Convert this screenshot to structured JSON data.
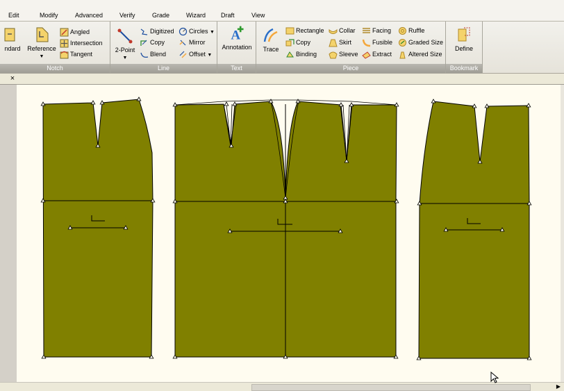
{
  "menubar": {
    "items": [
      "Edit",
      "Modify",
      "Advanced",
      "Verify",
      "Grade",
      "Wizard",
      "Draft",
      "View"
    ]
  },
  "ribbon": {
    "groups": {
      "notch": {
        "label": "Notch",
        "buttons": [
          "ndard",
          "Reference",
          "Angled",
          "Intersection",
          "Tangent"
        ]
      },
      "line": {
        "label": "Line",
        "buttons": [
          "2-Point",
          "Digitized",
          "Copy",
          "Blend",
          "Circles",
          "Mirror",
          "Offset"
        ]
      },
      "text": {
        "label": "Text",
        "buttons": [
          "Annotation"
        ]
      },
      "piece": {
        "label": "Piece",
        "buttons": [
          "Trace",
          "Rectangle",
          "Copy",
          "Binding",
          "Collar",
          "Skirt",
          "Sleeve",
          "Facing",
          "Fusible",
          "Extract",
          "Ruffle",
          "Graded Size",
          "Altered Size"
        ]
      },
      "bookmark": {
        "label": "Bookmark",
        "buttons": [
          "Define"
        ]
      }
    }
  },
  "tabstrip": {
    "close_glyph": "×"
  },
  "canvas": {
    "fill_color": "#808000",
    "line_color": "#000000",
    "background_color": "#fffcf0",
    "pieces": [
      "back-skirt-left-piece",
      "front-skirt-piece",
      "back-skirt-right-piece"
    ]
  },
  "colors": {
    "ribbon_label_bar": "#a9a79f",
    "accent_yellow": "#f4d36b"
  }
}
